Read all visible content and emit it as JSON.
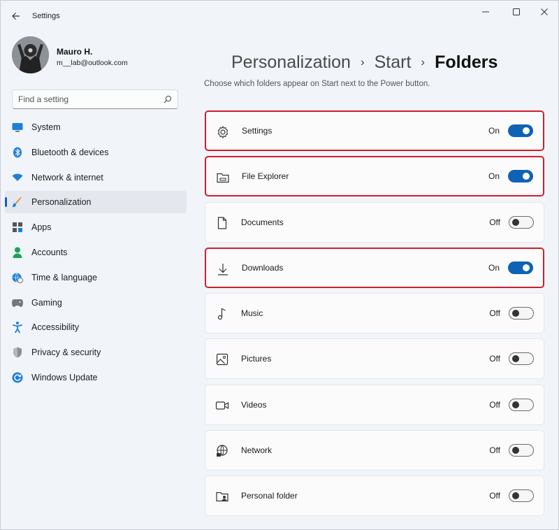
{
  "window": {
    "title": "Settings"
  },
  "user": {
    "name": "Mauro H.",
    "email": "m__lab@outlook.com"
  },
  "search": {
    "placeholder": "Find a setting"
  },
  "nav": [
    {
      "label": "System",
      "icon": "system-icon"
    },
    {
      "label": "Bluetooth & devices",
      "icon": "bluetooth-icon"
    },
    {
      "label": "Network & internet",
      "icon": "wifi-icon"
    },
    {
      "label": "Personalization",
      "icon": "brush-icon",
      "active": true
    },
    {
      "label": "Apps",
      "icon": "apps-icon"
    },
    {
      "label": "Accounts",
      "icon": "accounts-icon"
    },
    {
      "label": "Time & language",
      "icon": "globe-clock-icon"
    },
    {
      "label": "Gaming",
      "icon": "gamepad-icon"
    },
    {
      "label": "Accessibility",
      "icon": "accessibility-icon"
    },
    {
      "label": "Privacy & security",
      "icon": "shield-icon"
    },
    {
      "label": "Windows Update",
      "icon": "update-icon"
    }
  ],
  "breadcrumb": {
    "level1": "Personalization",
    "level2": "Start",
    "current": "Folders"
  },
  "description": "Choose which folders appear on Start next to the Power button.",
  "folders": [
    {
      "label": "Settings",
      "state": "On",
      "on": true,
      "icon": "gear-icon"
    },
    {
      "label": "File Explorer",
      "state": "On",
      "on": true,
      "icon": "file-explorer-icon"
    },
    {
      "label": "Documents",
      "state": "Off",
      "on": false,
      "icon": "document-icon"
    },
    {
      "label": "Downloads",
      "state": "On",
      "on": true,
      "icon": "download-icon"
    },
    {
      "label": "Music",
      "state": "Off",
      "on": false,
      "icon": "music-icon"
    },
    {
      "label": "Pictures",
      "state": "Off",
      "on": false,
      "icon": "picture-icon"
    },
    {
      "label": "Videos",
      "state": "Off",
      "on": false,
      "icon": "video-icon"
    },
    {
      "label": "Network",
      "state": "Off",
      "on": false,
      "icon": "network-icon"
    },
    {
      "label": "Personal folder",
      "state": "Off",
      "on": false,
      "icon": "personal-folder-icon"
    }
  ],
  "colors": {
    "accent": "#1062b5",
    "highlight": "#cf1f2e"
  }
}
